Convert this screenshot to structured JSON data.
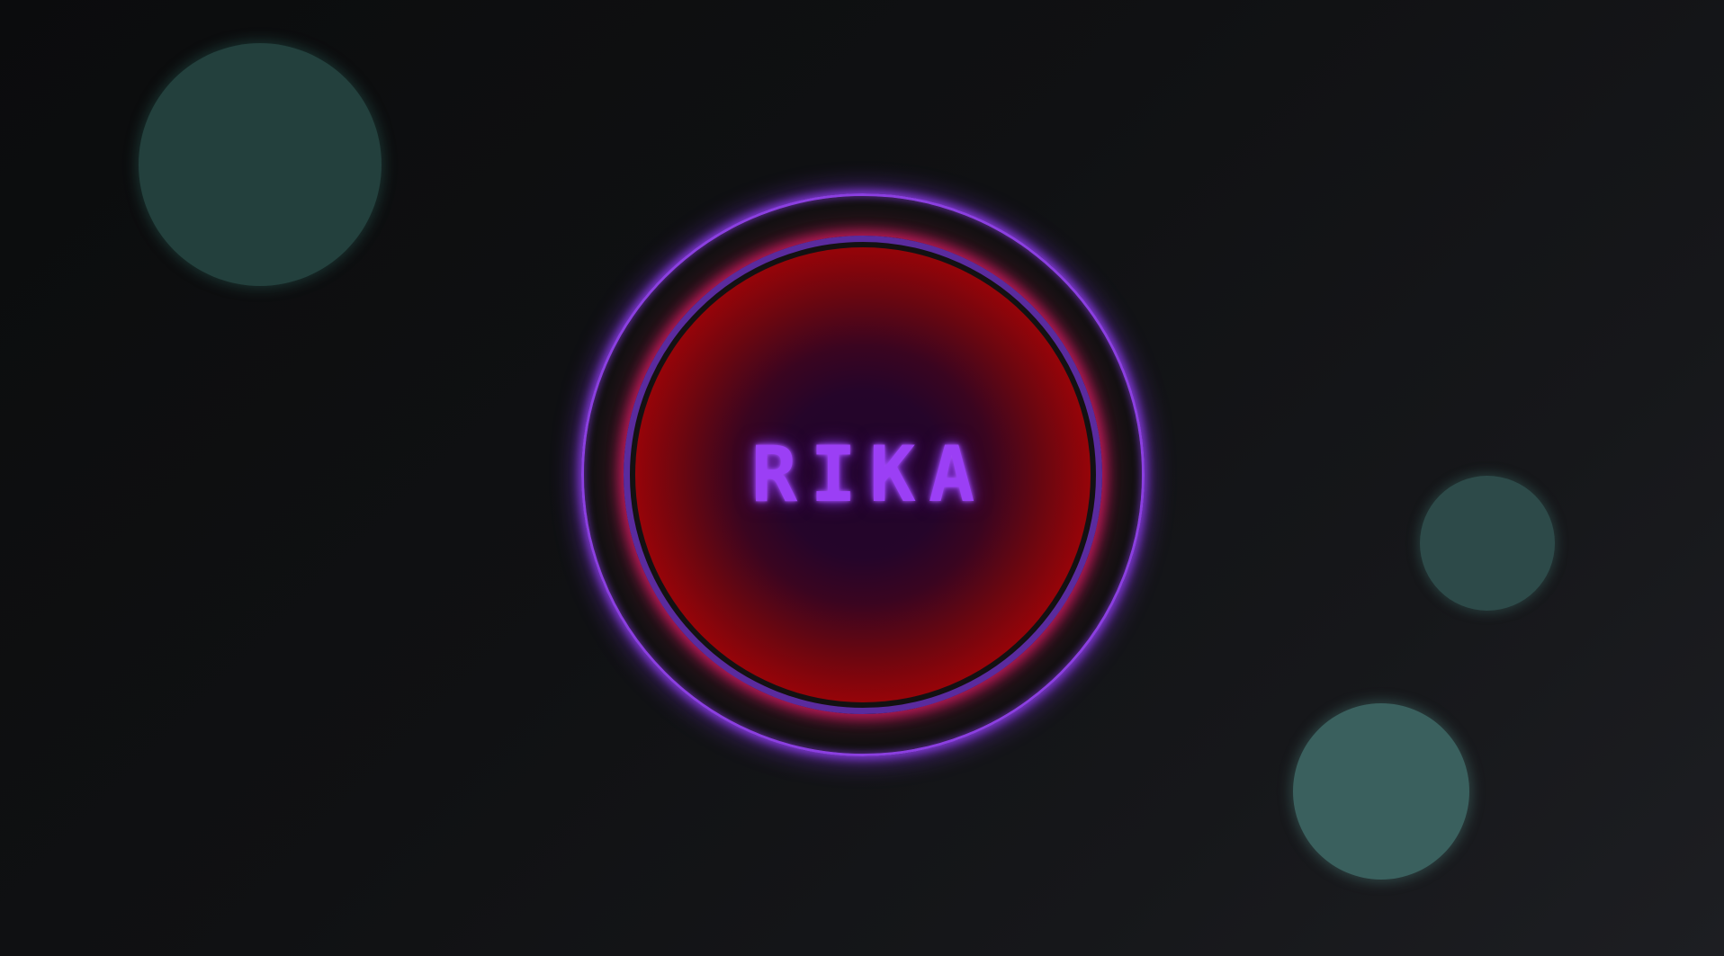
{
  "app": {
    "label": "RIKA"
  },
  "colors": {
    "outer_ring_glow": "#8b3fe0",
    "middle_ring": "#5a2b9e",
    "middle_ring_glow": "#e61e6e",
    "core_edge": "#b80000",
    "core_center": "#21052a",
    "label": "#9b3ff5",
    "orb_top_left": "#23403d",
    "orb_right": "#2d4a49",
    "orb_bottom_right": "#3a605e"
  }
}
